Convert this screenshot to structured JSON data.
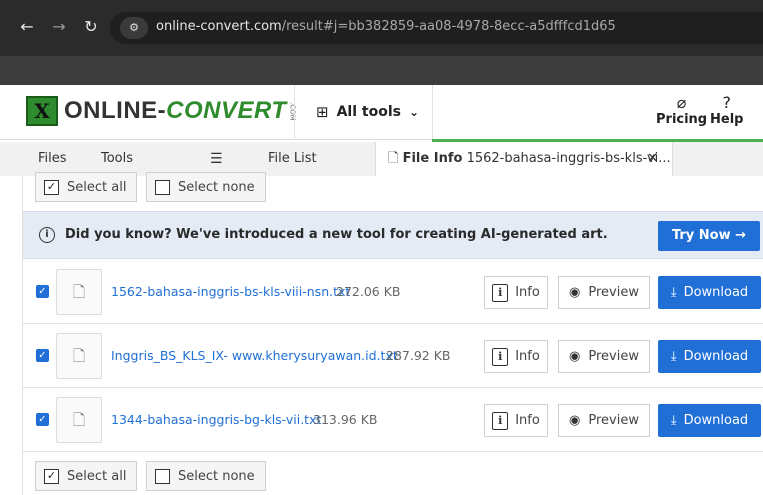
{
  "browser": {
    "url_domain": "online-convert.com",
    "url_rest": "/result#j=bb382859-aa08-4978-8ecc-a5dfffcd1d65",
    "back_icon": "arrow-left-icon",
    "forward_icon": "arrow-right-icon",
    "reload_icon": "reload-icon"
  },
  "header": {
    "logo_text_1": "ONLINE-",
    "logo_text_2": "CONVERT",
    "logo_sub": ".COM",
    "all_tools_label": "All tools",
    "pricing_label": "Pricing",
    "help_label": "Help"
  },
  "tabs": {
    "files_label": "Files",
    "tools_label": "Tools",
    "file_list_label": "File List",
    "file_info_label": "File Info",
    "active_file_label": "1562-bahasa-inggris-bs-kls-vi..."
  },
  "selection": {
    "select_all_label": "Select all",
    "select_none_label": "Select none"
  },
  "banner": {
    "text": "Did you know? We've introduced a new tool for creating AI-generated art.",
    "button_label": "Try Now →"
  },
  "files": [
    {
      "name": "1562-bahasa-inggris-bs-kls-viii-nsn.txt",
      "size": "272.06 KB"
    },
    {
      "name": "Inggris_BS_KLS_IX- www.kherysuryawan.id.txt",
      "size": "287.92 KB"
    },
    {
      "name": "1344-bahasa-inggris-bg-kls-vii.txt",
      "size": "313.96 KB"
    }
  ],
  "row_actions": {
    "info_label": "Info",
    "preview_label": "Preview",
    "download_label": "Download"
  },
  "colors": {
    "accent_blue": "#1f6fd6",
    "brand_green": "#2e8b2e",
    "banner_bg": "#e4ebf5"
  }
}
